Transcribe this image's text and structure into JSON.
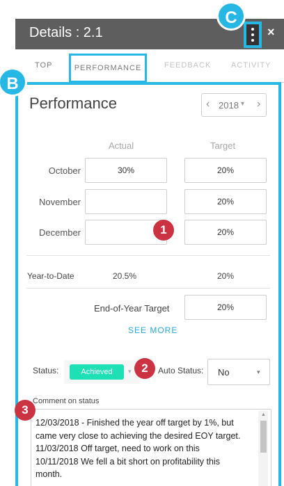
{
  "header": {
    "title": "Details : 2.1",
    "close_glyph": "×",
    "menu_icon": "kebab-menu-icon"
  },
  "tabs": [
    {
      "label": "TOP"
    },
    {
      "label": "PERFORMANCE"
    },
    {
      "label": "FEEDBACK"
    },
    {
      "label": "ACTIVITY"
    }
  ],
  "performance": {
    "title": "Performance",
    "year": {
      "prev": "‹",
      "value": "2018",
      "caret": "▾",
      "next": "›"
    },
    "columns": {
      "actual": "Actual",
      "target": "Target"
    },
    "months": [
      {
        "label": "October",
        "actual": "30%",
        "target": "20%"
      },
      {
        "label": "November",
        "actual": "",
        "target": "20%"
      },
      {
        "label": "December",
        "actual": "",
        "target": "20%"
      }
    ],
    "ytd": {
      "label": "Year-to-Date",
      "actual": "20.5%",
      "target": "20%"
    },
    "eoy": {
      "label": "End-of-Year Target",
      "value": "20%"
    },
    "see_more": "SEE MORE"
  },
  "status": {
    "label": "Status:",
    "value": "Achieved",
    "caret": "▾",
    "auto_label": "Auto Status:",
    "auto_value": "No",
    "auto_caret": "▾"
  },
  "comment": {
    "label": "Comment on status",
    "text": "12/03/2018 - Finished the year off target by 1%, but came very close to achieving the desired EOY target.\n11/03/2018 Off target, need to work on this\n10/11/2018 We fell a bit short on profitability this month.",
    "scroll_up": "▲"
  },
  "callouts": {
    "one": "1",
    "two": "2",
    "three": "3",
    "b": "B",
    "c": "C"
  },
  "colors": {
    "accent": "#26b7e4",
    "callout_red": "#cc3342",
    "achieved": "#1de0b5",
    "header_bg": "#5e5e5e"
  }
}
